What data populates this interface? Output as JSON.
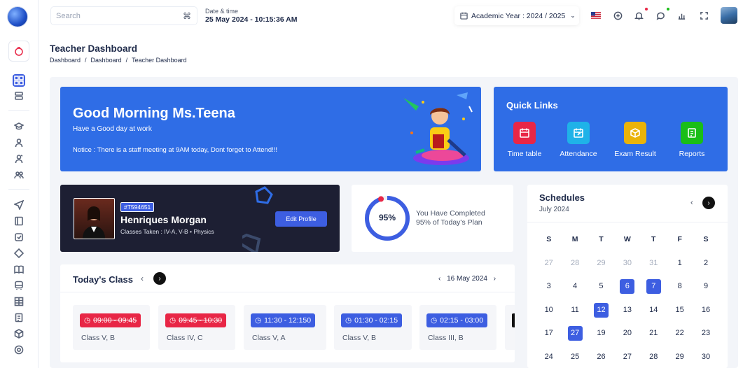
{
  "topbar": {
    "search_placeholder": "Search",
    "search_shortcut": "⌘",
    "datetime_label": "Date & time",
    "datetime_value": "25 May 2024 - 10:15:36 AM",
    "academic_year": "Academic Year : 2024 / 2025"
  },
  "page": {
    "title": "Teacher Dashboard",
    "breadcrumb": [
      "Dashboard",
      "/",
      "Dashboard",
      "/",
      "Teacher Dashboard"
    ]
  },
  "greeting": {
    "title": "Good Morning Ms.Teena",
    "subtitle": "Have a Good day at work",
    "notice": "Notice :  There is a staff meeting at  9AM today, Dont forget to Attend!!!"
  },
  "quick_links": {
    "title": "Quick Links",
    "items": [
      {
        "label": "Time table",
        "color": "#e82646",
        "icon": "calendar-icon"
      },
      {
        "label": "Attendance",
        "color": "#1fb2e8",
        "icon": "calendar-share-icon"
      },
      {
        "label": "Exam Result",
        "color": "#eab308",
        "icon": "box-icon"
      },
      {
        "label": "Reports",
        "color": "#1abe17",
        "icon": "report-icon"
      }
    ]
  },
  "profile": {
    "id": "#T594651",
    "name": "Henriques Morgan",
    "classes": "Classes Taken : IV-A, V-B  •  Physics",
    "edit_label": "Edit Profile"
  },
  "progress": {
    "percent_label": "95%",
    "percent": 95,
    "line1": "You Have Completed",
    "line2": "95% of Today's Plan"
  },
  "todays_class": {
    "title": "Today's Class",
    "date": "16 May 2024",
    "slots": [
      {
        "time": "09:00 - 09:45",
        "class": "Class V, B",
        "status": "done"
      },
      {
        "time": "09:45 - 10:30",
        "class": "Class IV, C",
        "status": "done"
      },
      {
        "time": "11:30 - 12:150",
        "class": "Class V, A",
        "status": "upcoming"
      },
      {
        "time": "01:30 - 02:15",
        "class": "Class V, B",
        "status": "upcoming"
      },
      {
        "time": "02:15 - 03:00",
        "class": "Class III, B",
        "status": "upcoming"
      }
    ]
  },
  "schedules": {
    "title": "Schedules",
    "month": "July 2024",
    "weekdays": [
      "S",
      "M",
      "T",
      "W",
      "T",
      "F",
      "S"
    ],
    "weeks": [
      [
        "27",
        "28",
        "29",
        "30",
        "31",
        "1",
        "2"
      ],
      [
        "3",
        "4",
        "5",
        "6",
        "7",
        "8",
        "9"
      ],
      [
        "10",
        "11",
        "12",
        "13",
        "14",
        "15",
        "16"
      ],
      [
        "17",
        "27",
        "19",
        "20",
        "21",
        "22",
        "23"
      ],
      [
        "24",
        "25",
        "26",
        "27",
        "28",
        "29",
        "30"
      ]
    ]
  },
  "colors": {
    "primary": "#3d5ee1",
    "banner": "#2f6de6",
    "danger": "#e82646",
    "dark": "#1d1f33"
  }
}
